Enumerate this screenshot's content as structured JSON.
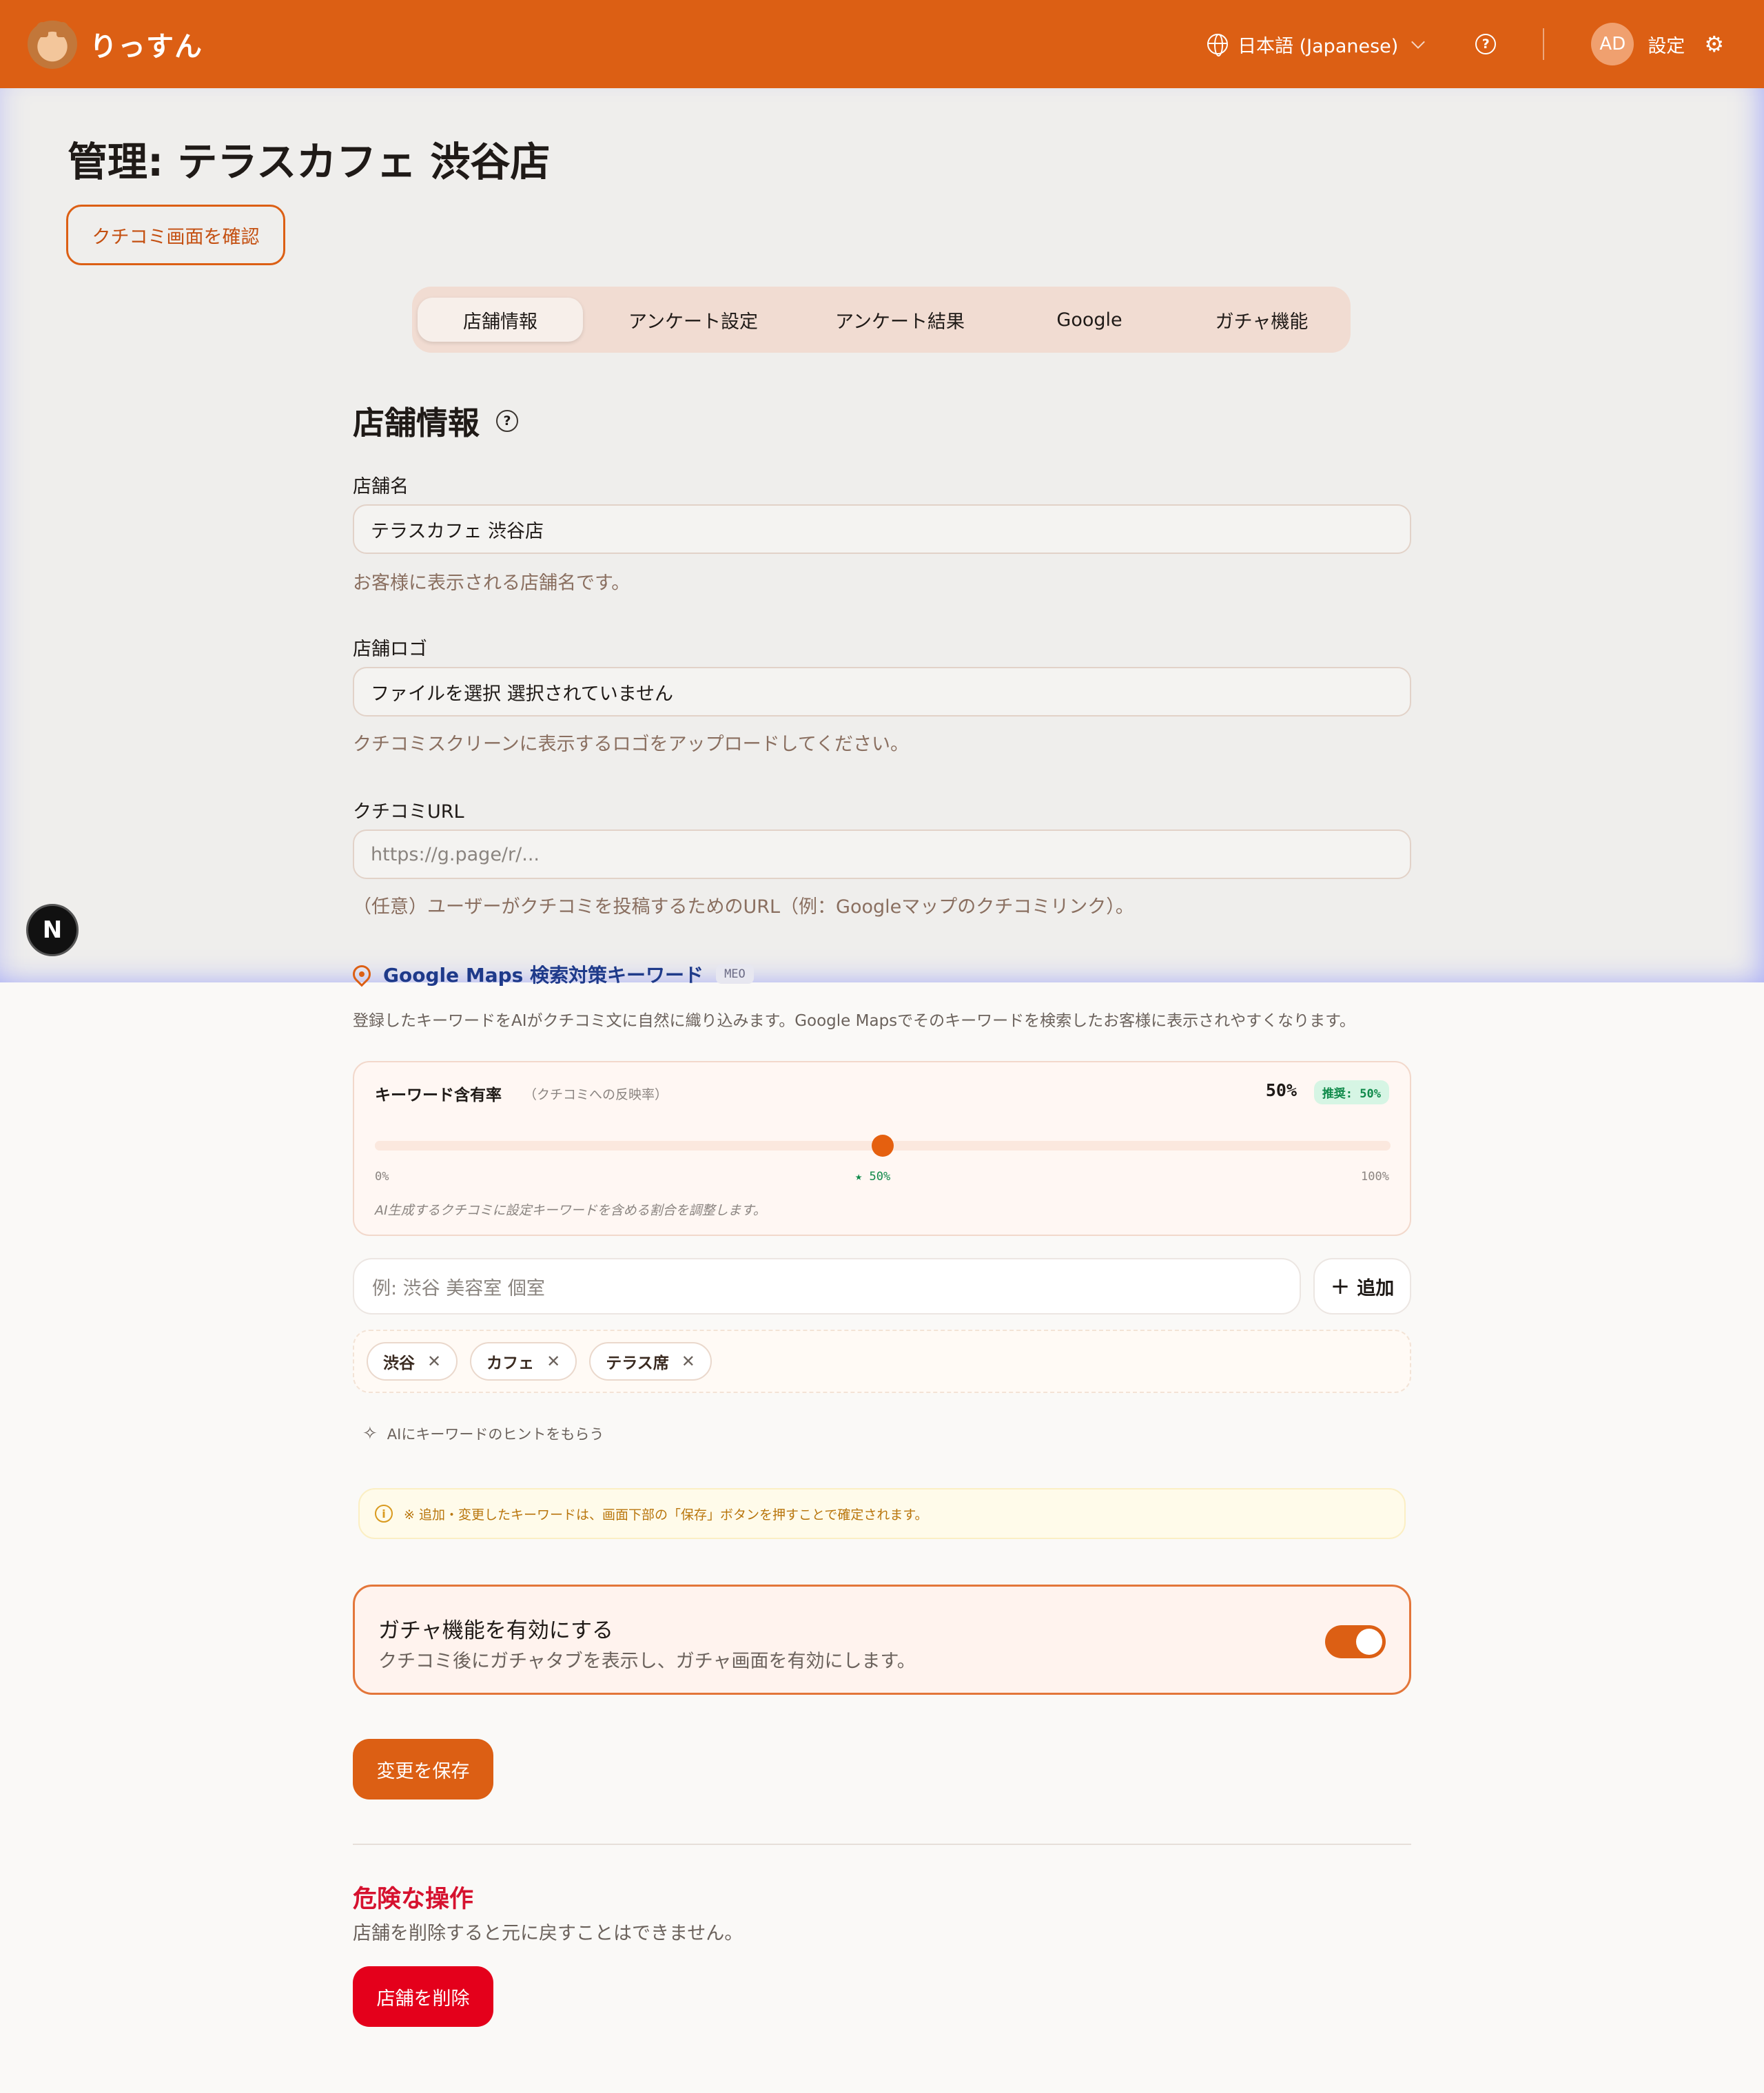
{
  "header": {
    "logo_text": "りっすん",
    "language": "日本語 (Japanese)",
    "help_icon": "question-circle-icon",
    "avatar_initials": "AD",
    "settings_label": "設定"
  },
  "page": {
    "title": "管理: テラスカフェ 渋谷店",
    "review_screen_button": "クチコミ画面を確認"
  },
  "tabs": [
    {
      "label": "店舗情報",
      "active": true
    },
    {
      "label": "アンケート設定",
      "active": false
    },
    {
      "label": "アンケート結果",
      "active": false
    },
    {
      "label": "Google",
      "active": false
    },
    {
      "label": "ガチャ機能",
      "active": false
    }
  ],
  "store_info": {
    "section_title": "店舗情報",
    "name": {
      "label": "店舗名",
      "value": "テラスカフェ 渋谷店",
      "hint": "お客様に表示される店舗名です。"
    },
    "logo": {
      "label": "店舗ロゴ",
      "value": "ファイルを選択 選択されていません",
      "hint": "クチコミスクリーンに表示するロゴをアップロードしてください。"
    },
    "review_url": {
      "label": "クチコミURL",
      "placeholder": "https://g.page/r/...",
      "hint": "（任意）ユーザーがクチコミを投稿するためのURL（例：Googleマップのクチコミリンク）。"
    }
  },
  "dev_badge": "N",
  "meo": {
    "title": "Google Maps 検索対策キーワード",
    "badge": "MEO",
    "description": "登録したキーワードをAIがクチコミ文に自然に織り込みます。Google Mapsでそのキーワードを検索したお客様に表示されやすくなります。",
    "rate": {
      "title": "キーワード含有率",
      "subtitle": "（クチコミへの反映率）",
      "value_label": "50%",
      "value": 50,
      "recommended": "推奨: 50%",
      "min_label": "0%",
      "mid_label": "★ 50%",
      "max_label": "100%",
      "note": "AI生成するクチコミに設定キーワードを含める割合を調整します。"
    },
    "input_placeholder": "例: 渋谷 美容室 個室",
    "add_button": "追加",
    "keywords": [
      "渋谷",
      "カフェ",
      "テラス席"
    ],
    "ai_hint": "AIにキーワードのヒントをもらう",
    "notice": "※ 追加・変更したキーワードは、画面下部の「保存」ボタンを押すことで確定されます。"
  },
  "gacha": {
    "title": "ガチャ機能を有効にする",
    "description": "クチコミ後にガチャタブを表示し、ガチャ画面を有効にします。",
    "enabled": true
  },
  "save_button": "変更を保存",
  "danger": {
    "title": "危険な操作",
    "description": "店舗を削除すると元に戻すことはできません。",
    "delete_button": "店舗を削除"
  },
  "colors": {
    "brand": "#dc5f14",
    "danger": "#e4001b",
    "success": "#0f8a4a"
  }
}
